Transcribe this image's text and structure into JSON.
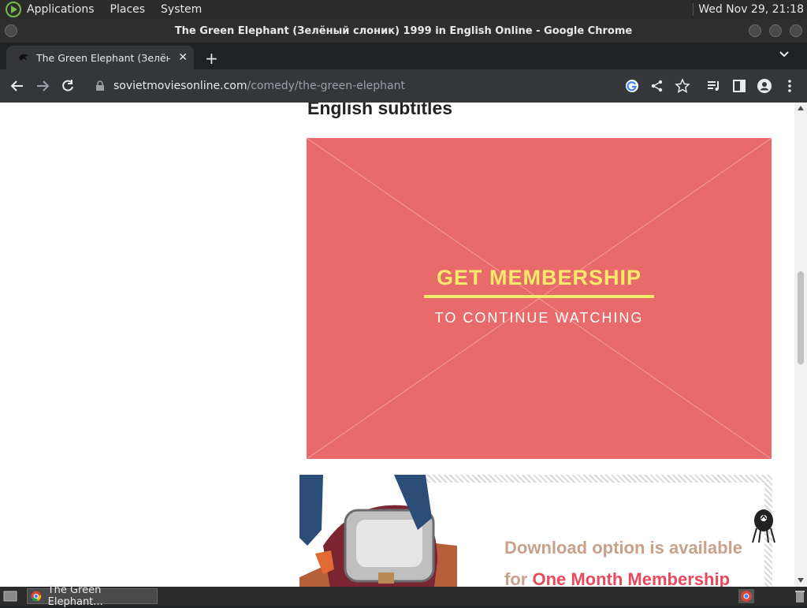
{
  "system_bar": {
    "menus": [
      "Applications",
      "Places",
      "System"
    ],
    "clock": "Wed Nov 29, 21:18"
  },
  "window": {
    "title": "The Green Elephant (Зелёный слоник) 1999 in English Online - Google Chrome"
  },
  "browser": {
    "tab_title": "The Green Elephant (Зелёный слоник) 1999 in English Online",
    "url_host": "sovietmoviesonline.com",
    "url_path": "/comedy/the-green-elephant"
  },
  "page": {
    "section_heading": "English subtitles",
    "promo": {
      "cta": "GET MEMBERSHIP",
      "sub": "TO CONTINUE WATCHING",
      "background_color": "#e96a6a",
      "cta_color": "#f7e96a"
    },
    "download": {
      "line1": "Download option is available",
      "line2_prefix": "for",
      "line2_accent": "One Month Membership"
    }
  },
  "taskbar": {
    "task_label": "The Green Elephant..."
  }
}
